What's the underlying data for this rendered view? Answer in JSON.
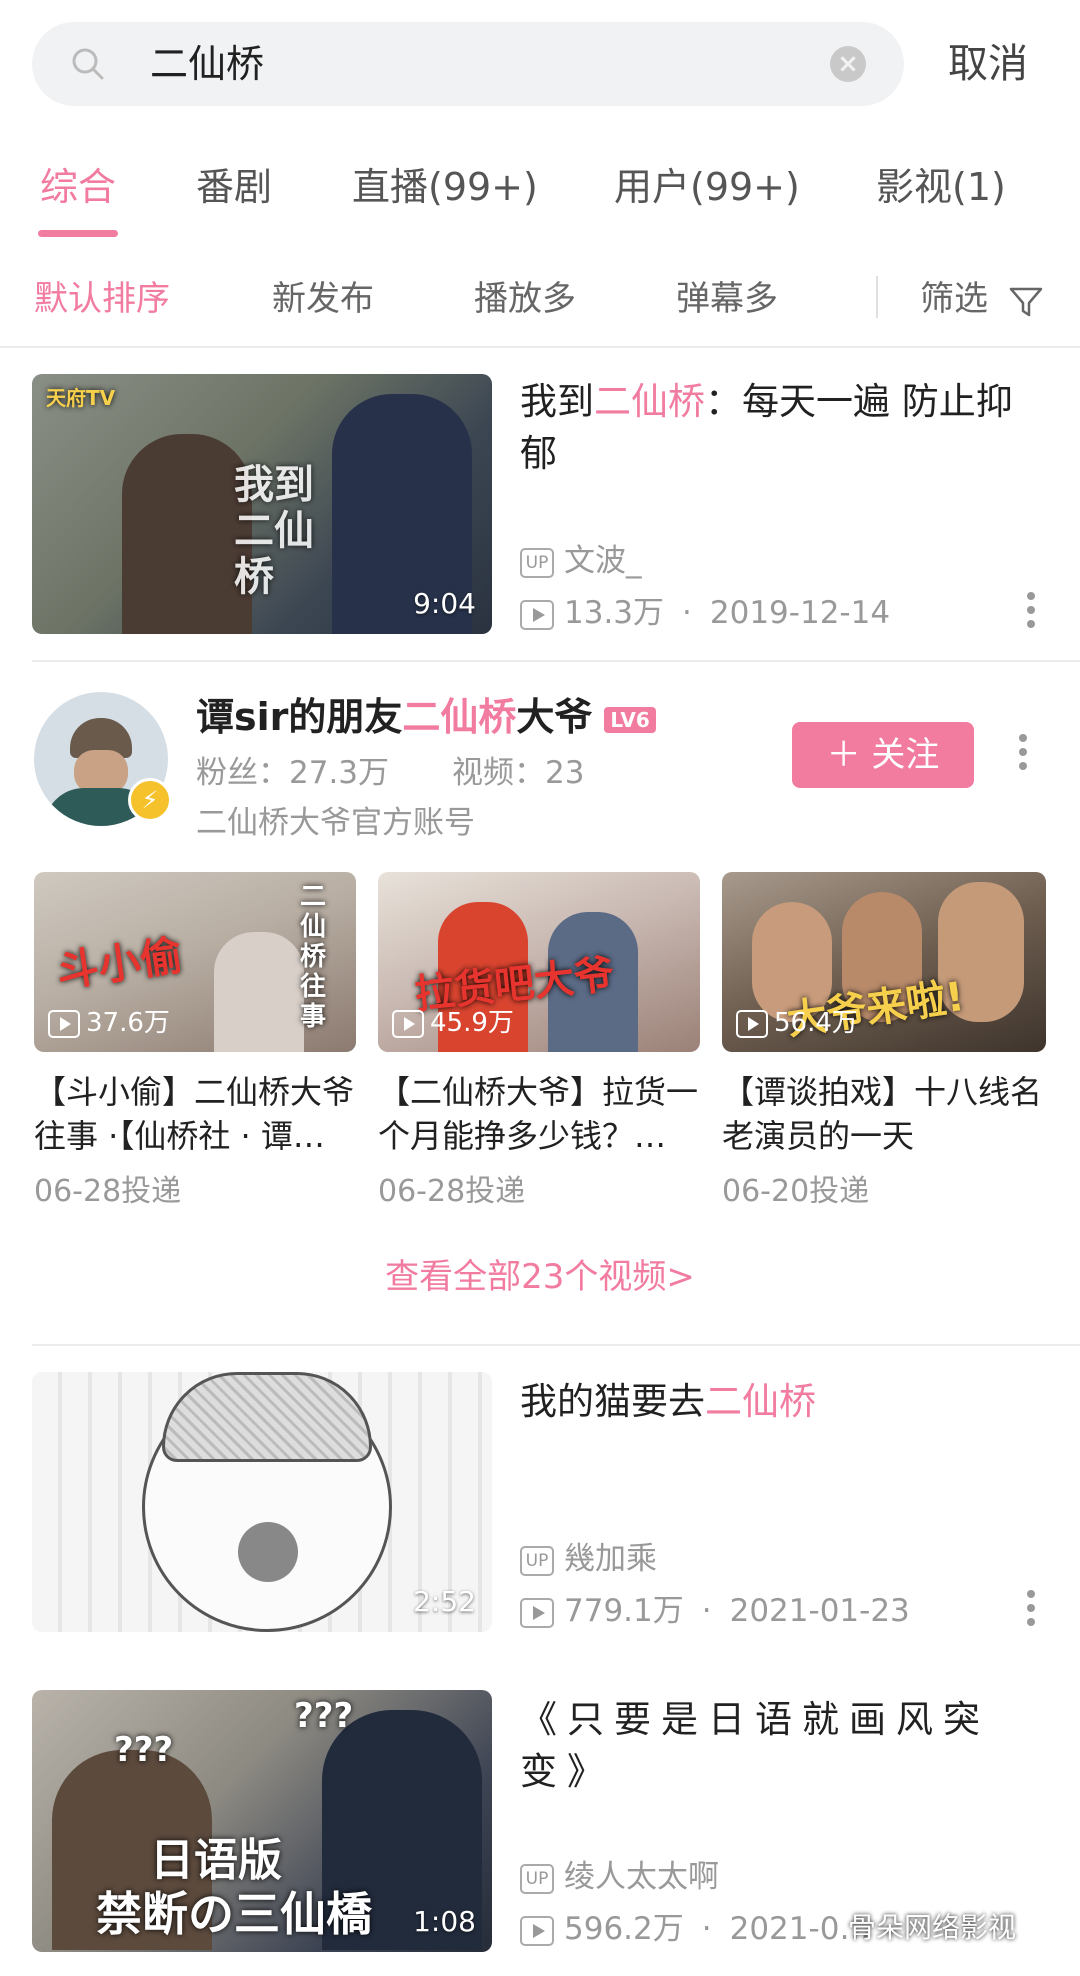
{
  "search": {
    "query": "二仙桥",
    "cancel_label": "取消"
  },
  "tabs": [
    {
      "label": "综合"
    },
    {
      "label": "番剧"
    },
    {
      "label": "直播(99+)"
    },
    {
      "label": "用户(99+)"
    },
    {
      "label": "影视(1)"
    }
  ],
  "sort": {
    "options": [
      "默认排序",
      "新发布",
      "播放多",
      "弹幕多"
    ],
    "filter_label": "筛选"
  },
  "results": {
    "video1": {
      "title_pre": "我到",
      "title_hl": "二仙桥",
      "title_post": "：每天一遍 防止抑郁",
      "thumb_overlay": "我到\n二仙桥",
      "thumb_logo": "天府TV",
      "duration": "9:04",
      "uploader": "文波_",
      "views": "13.3万",
      "date": "2019-12-14"
    },
    "user": {
      "name_pre": "谭sir的朋友",
      "name_hl": "二仙桥",
      "name_post": "大爷",
      "level": "LV6",
      "fans": "粉丝：27.3万",
      "videos": "视频：23",
      "desc": "二仙桥大爷官方账号",
      "follow_label": "＋ 关注",
      "videos_list": [
        {
          "views": "37.6万",
          "overlay": "斗小偷",
          "side": "二仙桥往事",
          "title": "【斗小偷】二仙桥大爷往事 ·【仙桥社 · 谭…",
          "date": "06-28投递"
        },
        {
          "views": "45.9万",
          "overlay": "拉货吧大爷",
          "side": "",
          "title": "【二仙桥大爷】拉货一个月能挣多少钱？…",
          "date": "06-28投递"
        },
        {
          "views": "56.4万",
          "overlay": "大爷来啦!",
          "side": "",
          "title": "【谭谈拍戏】十八线名老演员的一天",
          "date": "06-20投递"
        }
      ],
      "view_all": "查看全部23个视频>"
    },
    "video2": {
      "title_pre": "我的猫要去",
      "title_hl": "二仙桥",
      "duration": "2:52",
      "uploader": "幾加乘",
      "views": "779.1万",
      "date": "2021-01-23"
    },
    "video3": {
      "title": "《只要是日语就画风突变》",
      "thumb_overlay_1": "日语版",
      "thumb_overlay_2": "禁断の三仙橋",
      "duration": "1:08",
      "uploader": "绫人太太啊",
      "views": "596.2万",
      "date": "2021-0…"
    }
  },
  "watermark": "骨朵网络影视",
  "colors": {
    "accent": "#f27ba0",
    "muted": "#999999"
  }
}
